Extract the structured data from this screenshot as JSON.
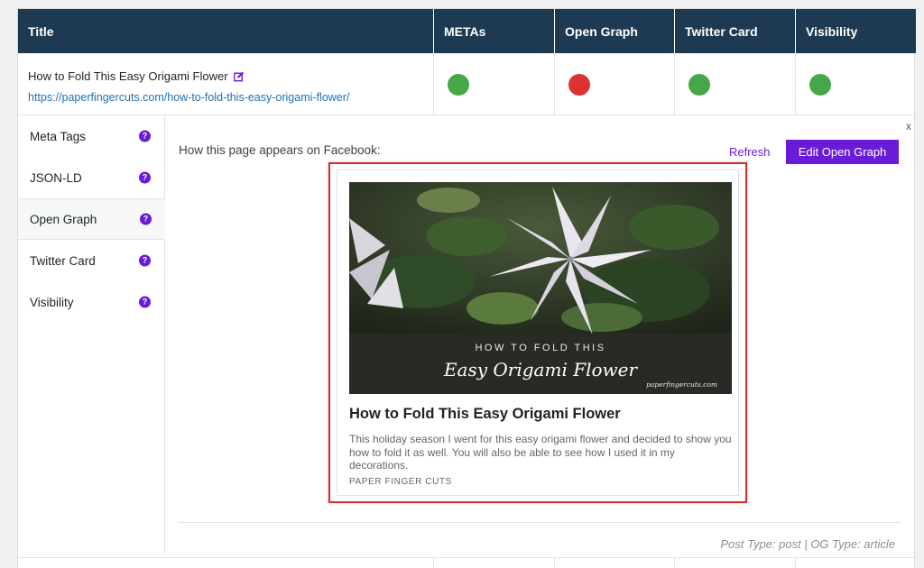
{
  "table": {
    "headers": [
      "Title",
      "METAs",
      "Open Graph",
      "Twitter Card",
      "Visibility"
    ],
    "row": {
      "title": "How to Fold This Easy Origami Flower",
      "url": "https://paperfingercuts.com/how-to-fold-this-easy-origami-flower/",
      "statuses": [
        {
          "name": "METAs",
          "state": "ok",
          "color": "#46a748"
        },
        {
          "name": "Open Graph",
          "state": "error",
          "color": "#dc3232"
        },
        {
          "name": "Twitter Card",
          "state": "ok",
          "color": "#46a748"
        },
        {
          "name": "Visibility",
          "state": "ok",
          "color": "#46a748"
        }
      ]
    }
  },
  "sidebar": {
    "items": [
      {
        "label": "Meta Tags",
        "active": false
      },
      {
        "label": "JSON-LD",
        "active": false
      },
      {
        "label": "Open Graph",
        "active": true
      },
      {
        "label": "Twitter Card",
        "active": false
      },
      {
        "label": "Visibility",
        "active": false
      }
    ],
    "help_glyph": "?"
  },
  "panel": {
    "close_label": "x",
    "facebook_label": "How this page appears on Facebook:",
    "refresh_label": "Refresh",
    "edit_button_label": "Edit Open Graph",
    "preview": {
      "image_line1": "HOW TO FOLD THIS",
      "image_line2": "Easy Origami Flower",
      "image_site": "paperfingercuts.com",
      "title": "How to Fold This Easy Origami Flower",
      "description": "This holiday season I went for this easy origami flower and decided to show you how to fold it as well. You will also be able to see how I used it in my decorations.",
      "site_name": "PAPER FINGER CUTS"
    },
    "types": "Post Type: post | OG Type: article"
  },
  "colors": {
    "header_bg": "#1e3a52",
    "accent": "#6a1bd8",
    "ok": "#46a748",
    "error": "#dc3232",
    "highlight_border": "#d32f2f"
  }
}
